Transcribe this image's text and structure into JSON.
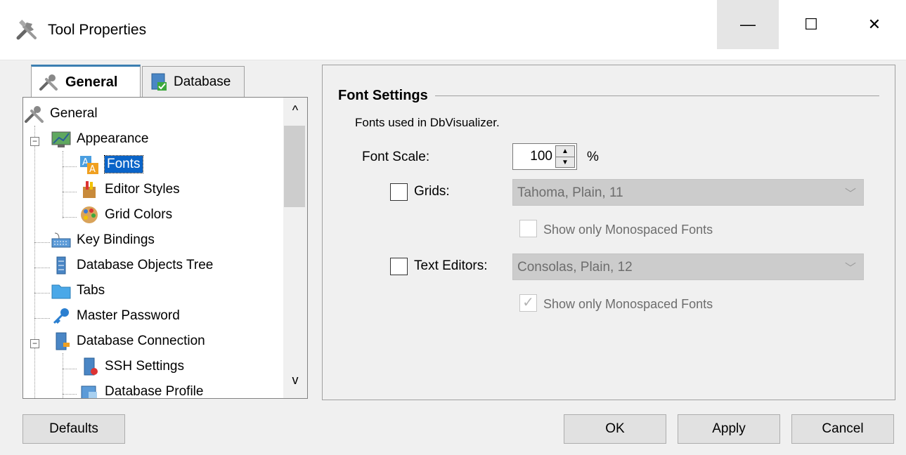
{
  "window": {
    "title": "Tool Properties",
    "minimize_glyph": "—",
    "maximize_glyph": "☐",
    "close_glyph": "✕"
  },
  "tabs": [
    {
      "label": "General",
      "icon": "tools-icon",
      "active": true
    },
    {
      "label": "Database",
      "icon": "database-icon",
      "active": false
    }
  ],
  "tree": {
    "items": [
      {
        "label": "General",
        "icon": "tools-icon"
      },
      {
        "label": "Appearance",
        "icon": "monitor-icon",
        "expanded": true
      },
      {
        "label": "Fonts",
        "icon": "font-icon",
        "selected": true
      },
      {
        "label": "Editor Styles",
        "icon": "brush-icon"
      },
      {
        "label": "Grid Colors",
        "icon": "palette-icon"
      },
      {
        "label": "Key Bindings",
        "icon": "keyboard-icon"
      },
      {
        "label": "Database Objects Tree",
        "icon": "tree-icon"
      },
      {
        "label": "Tabs",
        "icon": "folder-icon"
      },
      {
        "label": "Master Password",
        "icon": "key-icon"
      },
      {
        "label": "Database Connection",
        "icon": "server-icon",
        "expanded": true
      },
      {
        "label": "SSH Settings",
        "icon": "ssh-icon"
      },
      {
        "label": "Database Profile",
        "icon": "profile-icon"
      }
    ],
    "scroll_up": "^",
    "scroll_down": "v"
  },
  "panel": {
    "section_title": "Font Settings",
    "description": "Fonts used in DbVisualizer.",
    "font_scale_label": "Font Scale:",
    "font_scale_value": "100",
    "font_scale_unit": "%",
    "grids": {
      "label": "Grids:",
      "checked": false,
      "value": "Tahoma, Plain, 11",
      "mono_label": "Show only Monospaced Fonts",
      "mono_checked": false
    },
    "text_editors": {
      "label": "Text Editors:",
      "checked": false,
      "value": "Consolas, Plain, 12",
      "mono_label": "Show only Monospaced Fonts",
      "mono_checked": true
    }
  },
  "buttons": {
    "defaults": "Defaults",
    "ok": "OK",
    "apply": "Apply",
    "cancel": "Cancel"
  },
  "colors": {
    "selection": "#0a64c8",
    "tab_accent": "#3c7fb1"
  }
}
